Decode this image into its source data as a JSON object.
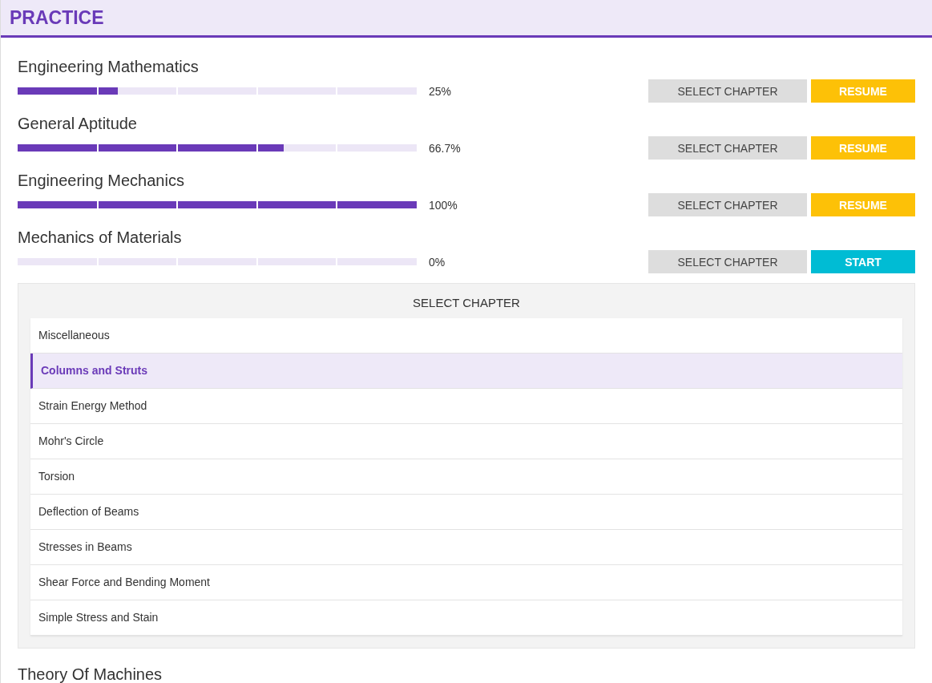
{
  "header": {
    "title": "PRACTICE"
  },
  "subjects": [
    {
      "title": "Engineering Mathematics",
      "level": 0.25,
      "reading": "25%",
      "select_button": "SELECT CHAPTER",
      "action": {
        "label": "RESUME",
        "kind": "resume"
      }
    },
    {
      "title": "General Aptitude",
      "level": 0.667,
      "reading": "66.7%",
      "select_button": "SELECT CHAPTER",
      "action": {
        "label": "RESUME",
        "kind": "resume"
      }
    },
    {
      "title": "Engineering Mechanics",
      "level": 1,
      "reading": "100%",
      "select_button": "SELECT CHAPTER",
      "action": {
        "label": "RESUME",
        "kind": "resume"
      }
    },
    {
      "title": "Mechanics of Materials",
      "level": 0,
      "reading": "0%",
      "select_button": "SELECT CHAPTER",
      "action": {
        "label": "START",
        "kind": "start"
      },
      "chapter_panel": {
        "title": "SELECT CHAPTER",
        "chapters": [
          {
            "label": "Miscellaneous",
            "selected": false
          },
          {
            "label": "Columns and Struts",
            "selected": true
          },
          {
            "label": "Strain Energy Method",
            "selected": false
          },
          {
            "label": "Mohr's Circle",
            "selected": false
          },
          {
            "label": "Torsion",
            "selected": false
          },
          {
            "label": "Deflection of Beams",
            "selected": false
          },
          {
            "label": "Stresses in Beams",
            "selected": false
          },
          {
            "label": "Shear Force and Bending Moment",
            "selected": false
          },
          {
            "label": "Simple Stress and Stain",
            "selected": false
          }
        ]
      }
    },
    {
      "title": "Theory Of Machines"
    }
  ]
}
